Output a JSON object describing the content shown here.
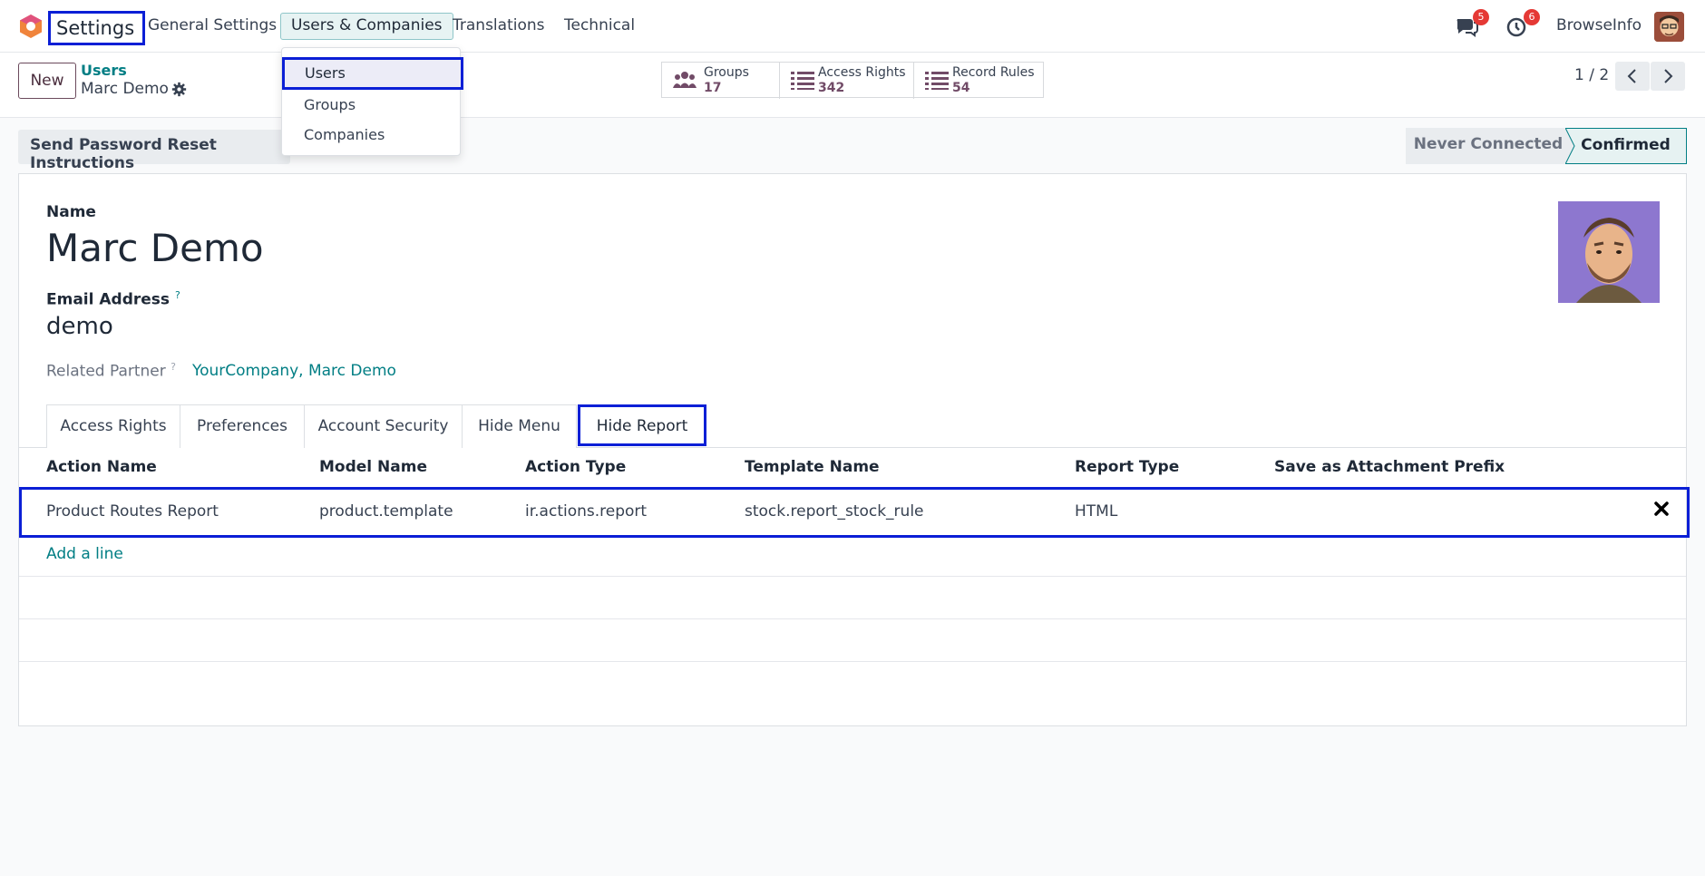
{
  "app": {
    "name": "Settings"
  },
  "nav": {
    "menus": [
      "General Settings",
      "Users & Companies",
      "Translations",
      "Technical"
    ],
    "dropdown": [
      "Users",
      "Groups",
      "Companies"
    ],
    "messages_count": "5",
    "activities_count": "6",
    "company": "BrowseInfo"
  },
  "control": {
    "new_label": "New",
    "breadcrumb_parent": "Users",
    "breadcrumb_current": "Marc Demo",
    "smart_buttons": [
      {
        "label": "Groups",
        "value": "17",
        "icon": "users-icon"
      },
      {
        "label": "Access Rights",
        "value": "342",
        "icon": "list-icon"
      },
      {
        "label": "Record Rules",
        "value": "54",
        "icon": "list-icon"
      }
    ],
    "pager": "1 / 2"
  },
  "statusbar": {
    "reset_button": "Send Password Reset Instructions",
    "stages": [
      "Never Connected",
      "Confirmed"
    ],
    "current_stage": "Confirmed"
  },
  "form": {
    "name_label": "Name",
    "name_value": "Marc Demo",
    "email_label": "Email Address",
    "email_value": "demo",
    "partner_label": "Related Partner",
    "partner_value": "YourCompany, Marc Demo",
    "help_mark": "?"
  },
  "tabs": [
    "Access Rights",
    "Preferences",
    "Account Security",
    "Hide Menu",
    "Hide Report"
  ],
  "active_tab": "Hide Report",
  "table": {
    "columns": [
      "Action Name",
      "Model Name",
      "Action Type",
      "Template Name",
      "Report Type",
      "Save as Attachment Prefix"
    ],
    "rows": [
      [
        "Product Routes Report",
        "product.template",
        "ir.actions.report",
        "stock.report_stock_rule",
        "HTML",
        ""
      ]
    ],
    "add_line": "Add a line"
  },
  "colors": {
    "brand": "#714b67",
    "accent": "#017e84",
    "highlight_box": "#0b1fd6",
    "badge": "#e53935"
  }
}
